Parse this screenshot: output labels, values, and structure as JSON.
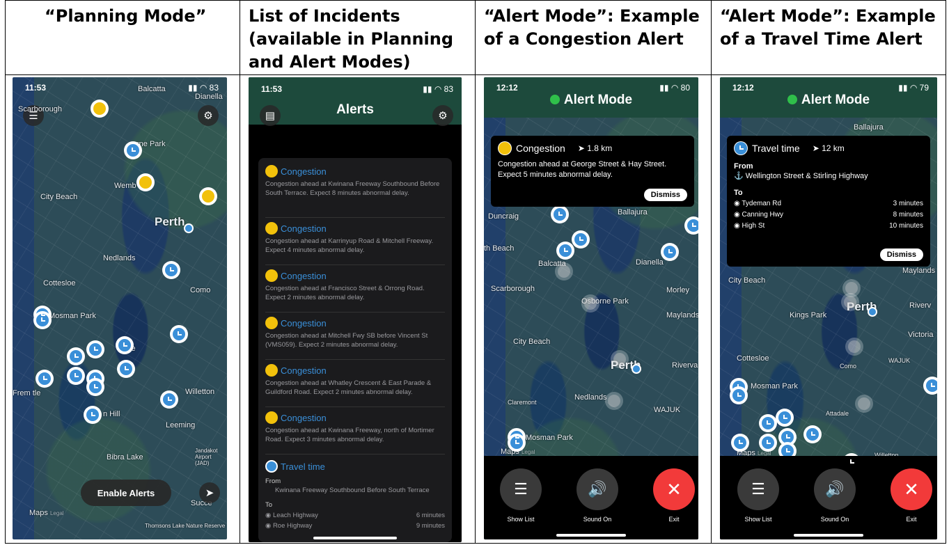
{
  "headers": {
    "col1": "“Planning Mode”",
    "col2_line1": "List of Incidents",
    "col2_line2": "(available in Planning",
    "col2_line3": "and Alert Modes)",
    "col3_line1": "“Alert Mode”: Example",
    "col3_line2": "of a Congestion Alert",
    "col4_line1": "“Alert Mode”: Example",
    "col4_line2": "of a Travel Time Alert"
  },
  "planning": {
    "time": "11:53",
    "battery": "83",
    "labels": {
      "scarborough": "Scarborough",
      "balcatta": "Balcatta",
      "dianella": "Dianella",
      "osborne_park": "rne Park",
      "wembley": "Wemb",
      "city_beach": "City Beach",
      "perth": "Perth",
      "nedlands": "Nedlands",
      "cottesloe": "Cottesloe",
      "como": "Como",
      "mosman_park": "Mosman Park",
      "willetton": "Willetton",
      "fremantle": "Frem   tle",
      "leeming": "Leeming",
      "bibra_lake": "Bibra Lake",
      "jandakot": "Jandakot Airport (JAD)",
      "maps": "Maps",
      "legal": "Legal",
      "thomsons": "Thomsons Lake Nature Reserve",
      "success": "Succe",
      "hill": "n Hill",
      "ale": "ale"
    },
    "enable_alerts": "Enable Alerts"
  },
  "alerts_list": {
    "time": "11:53",
    "battery": "83",
    "title": "Alerts",
    "items": [
      {
        "type": "Congestion",
        "desc": "Congestion ahead at Kwinana Freeway Southbound Before South Terrace. Expect 8 minutes abnormal delay."
      },
      {
        "type": "Congestion",
        "desc": "Congestion ahead at Karrinyup Road & Mitchell Freeway. Expect 4 minutes abnormal delay."
      },
      {
        "type": "Congestion",
        "desc": "Congestion ahead at Francisco Street & Orrong Road. Expect 2 minutes abnormal delay."
      },
      {
        "type": "Congestion",
        "desc": "Congestion ahead at Mitchell Fwy SB before Vincent St (VMS059). Expect 2 minutes abnormal delay."
      },
      {
        "type": "Congestion",
        "desc": "Congestion ahead at Whatley Crescent & East Parade & Guildford Road. Expect 2 minutes abnormal delay."
      },
      {
        "type": "Congestion",
        "desc": "Congestion ahead at Kwinana Freeway, north of Mortimer Road. Expect 3 minutes abnormal delay."
      }
    ],
    "travel": {
      "type": "Travel time",
      "from_label": "From",
      "from": "Kwinana Freeway Southbound Before South Terrace",
      "to_label": "To",
      "rows": [
        {
          "dest": "Leach Highway",
          "time": "6 minutes"
        },
        {
          "dest": "Roe Highway",
          "time": "9 minutes"
        }
      ]
    }
  },
  "congestion_alert": {
    "time": "12:12",
    "battery": "80",
    "mode_title": "Alert Mode",
    "card_type": "Congestion",
    "distance": "1.8 km",
    "desc": "Congestion ahead at George Street & Hay Street. Expect 5 minutes abnormal delay.",
    "dismiss": "Dismiss",
    "labels": {
      "duncraig": "Duncraig",
      "ballajura": "Ballajura",
      "balcatta": "Balcatta",
      "dianella": "Dianella",
      "th_beach": "th Beach",
      "scarborough": "Scarborough",
      "osborne_park": "Osborne Park",
      "morley": "Morley",
      "maylands": "Maylands",
      "city_beach": "City Beach",
      "perth": "Perth",
      "rivervale": "Riverva",
      "claremont": "Claremont",
      "nedlands": "Nedlands",
      "wajuk": "WAJUK",
      "mosman_park": "Mosman Park",
      "maps": "Maps",
      "legal": "Legal"
    },
    "controls": {
      "list": "Show List",
      "sound": "Sound On",
      "exit": "Exit"
    }
  },
  "travel_alert": {
    "time": "12:12",
    "battery": "79",
    "mode_title": "Alert Mode",
    "card_type": "Travel time",
    "distance": "12 km",
    "from_label": "From",
    "from": "Wellington Street & Stirling Highway",
    "to_label": "To",
    "rows": [
      {
        "dest": "Tydeman Rd",
        "time": "3 minutes"
      },
      {
        "dest": "Canning Hwy",
        "time": "8 minutes"
      },
      {
        "dest": "High St",
        "time": "10 minutes"
      }
    ],
    "dismiss": "Dismiss",
    "labels": {
      "ballajura": "Ballajura",
      "maylands": "Maylands",
      "city_beach": "City Beach",
      "perth": "Perth",
      "kings_park": "Kings Park",
      "river": "Riverv",
      "victoria": "Victoria",
      "cottesloe": "Cottesloe",
      "como": "Como",
      "wajuk": "WAJUK",
      "mosman_park": "Mosman Park",
      "attadale": "Attadale",
      "willetton": "Willetton",
      "maps": "Maps",
      "legal": "Legal"
    },
    "controls": {
      "list": "Show List",
      "sound": "Sound On",
      "exit": "Exit"
    }
  },
  "icons": [
    "list-icon",
    "settings-icon",
    "map-icon",
    "navigation-arrow-icon",
    "speaker-icon",
    "close-icon",
    "clock-icon",
    "car-icon"
  ]
}
